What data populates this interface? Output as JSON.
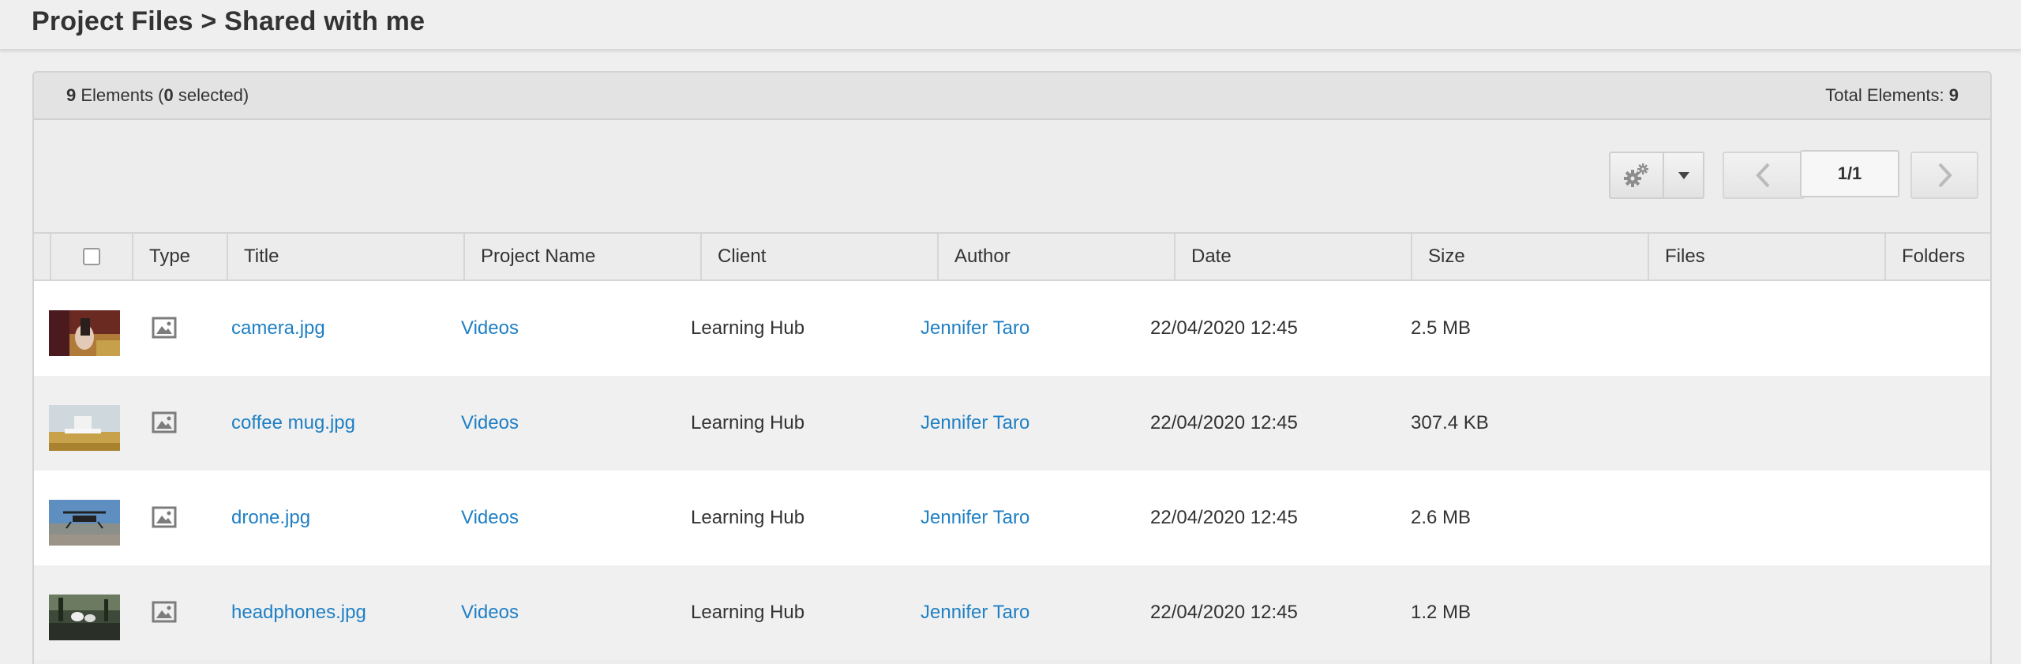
{
  "breadcrumb": "Project Files > Shared with me",
  "panel": {
    "elements_count": "9",
    "elements_label": " Elements (",
    "selected_count": "0",
    "selected_label": " selected)",
    "total_label": "Total Elements: ",
    "total_count": "9"
  },
  "pagination": {
    "page": "1/1"
  },
  "icons": {
    "gear": "gear-icon",
    "caret": "caret-down-icon",
    "prev": "chevron-left-icon",
    "next": "chevron-right-icon",
    "type": "image-file-icon"
  },
  "colors": {
    "link": "#1e7fc4",
    "header_bg": "#e3e3e3",
    "row_alt": "#f0f0f0"
  },
  "columns": [
    "Type",
    "Title",
    "Project Name",
    "Client",
    "Author",
    "Date",
    "Size",
    "Files",
    "Folders"
  ],
  "rows": [
    {
      "title": "camera.jpg",
      "project": "Videos",
      "client": "Learning Hub",
      "author": "Jennifer Taro",
      "date": "22/04/2020 12:45",
      "size": "2.5 MB",
      "thumb": "camera-photo-thumbnail"
    },
    {
      "title": "coffee mug.jpg",
      "project": "Videos",
      "client": "Learning Hub",
      "author": "Jennifer Taro",
      "date": "22/04/2020 12:45",
      "size": "307.4 KB",
      "thumb": "coffee-mug-photo-thumbnail"
    },
    {
      "title": "drone.jpg",
      "project": "Videos",
      "client": "Learning Hub",
      "author": "Jennifer Taro",
      "date": "22/04/2020 12:45",
      "size": "2.6 MB",
      "thumb": "drone-photo-thumbnail"
    },
    {
      "title": "headphones.jpg",
      "project": "Videos",
      "client": "Learning Hub",
      "author": "Jennifer Taro",
      "date": "22/04/2020 12:45",
      "size": "1.2 MB",
      "thumb": "headphones-photo-thumbnail"
    }
  ]
}
